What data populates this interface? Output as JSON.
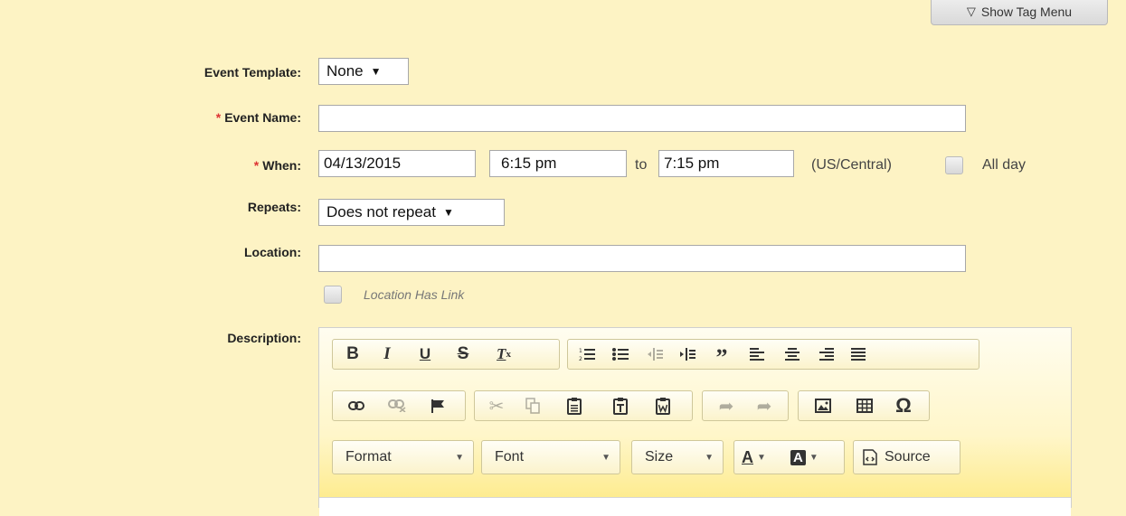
{
  "header": {
    "tag_menu_label": "Show Tag Menu"
  },
  "form": {
    "template_label": "Event Template:",
    "template_value": "None",
    "name_label": "Event Name:",
    "name_value": "",
    "when_label": "When:",
    "date_value": "04/13/2015",
    "start_time": "6:15 pm",
    "to_label": "to",
    "end_time": "7:15 pm",
    "timezone": "(US/Central)",
    "all_day_label": "All day",
    "all_day_checked": false,
    "repeats_label": "Repeats:",
    "repeats_value": "Does not repeat",
    "location_label": "Location:",
    "location_value": "",
    "location_link_label": "Location Has Link",
    "location_link_checked": false,
    "description_label": "Description:",
    "required_mark": "*"
  },
  "editor": {
    "toolbar_row1": [
      "bold",
      "italic",
      "underline",
      "strikethrough",
      "remove-format",
      "numbered-list",
      "bulleted-list",
      "decrease-indent",
      "increase-indent",
      "blockquote",
      "align-left",
      "align-center",
      "align-right",
      "justify"
    ],
    "toolbar_row2": [
      "link",
      "unlink",
      "anchor",
      "cut",
      "copy",
      "paste",
      "paste-as-text",
      "paste-from-word",
      "undo",
      "redo",
      "image",
      "table",
      "special-character"
    ],
    "format_label": "Format",
    "font_label": "Font",
    "size_label": "Size",
    "source_label": "Source",
    "text_color_glyph": "A",
    "bg_color_glyph": "A"
  }
}
